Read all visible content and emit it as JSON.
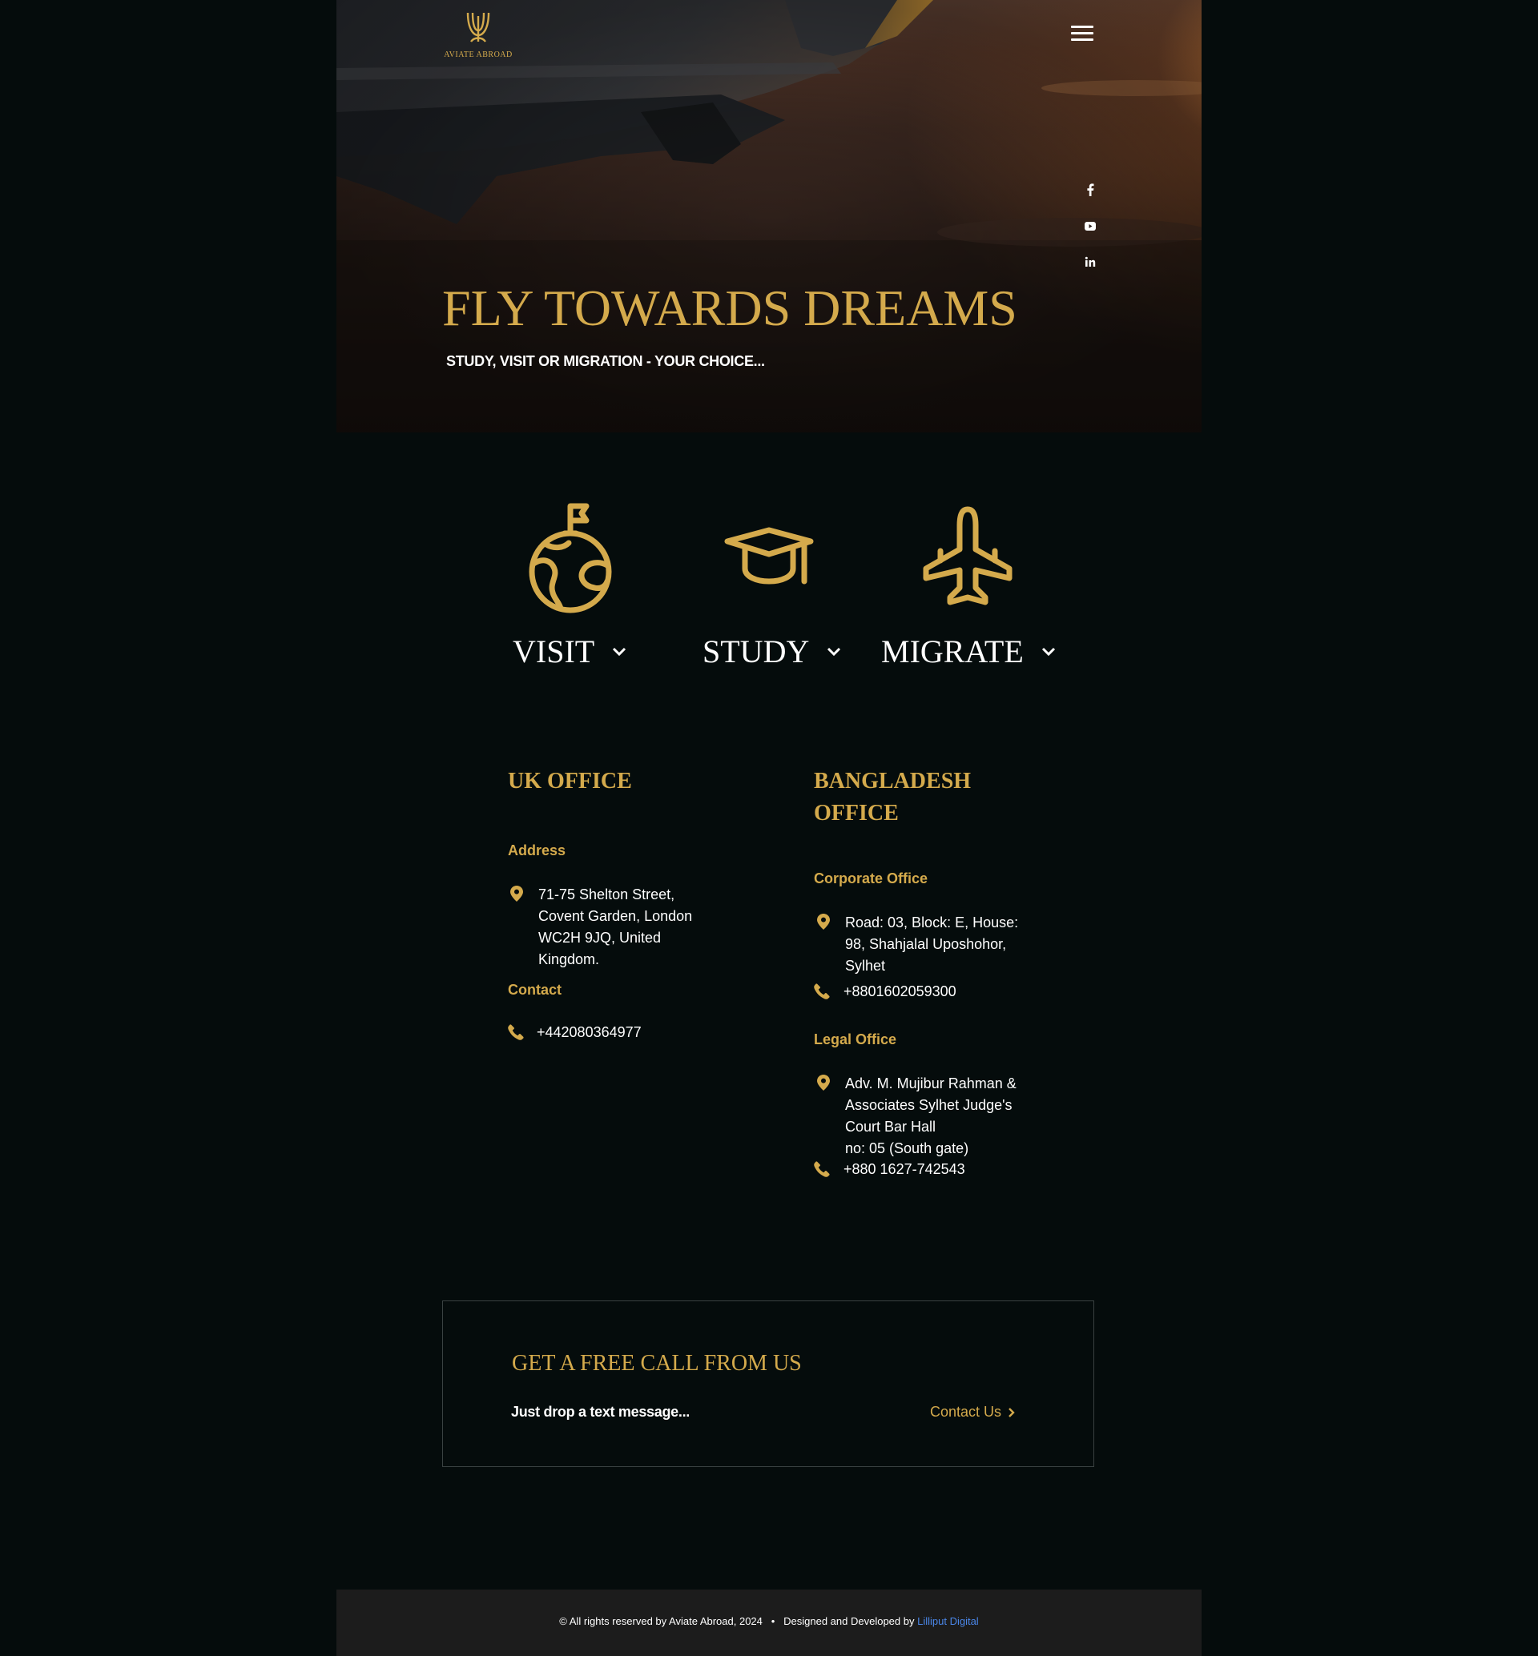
{
  "brand": {
    "name": "AVIATE ABROAD",
    "gold": "#d4aa4c"
  },
  "hero": {
    "title": "FLY TOWARDS DREAMS",
    "subtitle": "STUDY, VISIT OR MIGRATION - YOUR CHOICE...",
    "menu_icon": "hamburger-menu-icon",
    "social": [
      "facebook-icon",
      "youtube-icon",
      "linkedin-icon"
    ]
  },
  "services": [
    {
      "label": "VISIT",
      "icon": "globe-flag-icon"
    },
    {
      "label": "STUDY",
      "icon": "graduation-cap-icon"
    },
    {
      "label": "MIGRATE",
      "icon": "airplane-icon"
    }
  ],
  "uk_office": {
    "title": "UK OFFICE",
    "address_label": "Address",
    "address_lines": [
      "71-75 Shelton Street,",
      "Covent Garden, London",
      "WC2H 9JQ, United",
      "Kingdom."
    ],
    "contact_label": "Contact",
    "phone": "+442080364977"
  },
  "bd_office": {
    "title_line1": "BANGLADESH",
    "title_line2": "OFFICE",
    "corporate_label": "Corporate Office",
    "corporate_address_lines": [
      "Road: 03, Block: E, House:",
      "98, Shahjalal Uposhohor,",
      "Sylhet"
    ],
    "corporate_phone": "+8801602059300",
    "legal_label": "Legal Office",
    "legal_address_lines": [
      "Adv. M. Mujibur Rahman &",
      "Associates Sylhet Judge's",
      "Court Bar Hall",
      "no: 05 (South gate)"
    ],
    "legal_phone": "+880 1627-742543"
  },
  "cta": {
    "title": "GET A FREE CALL FROM US",
    "text": "Just drop a text message...",
    "link": "Contact Us"
  },
  "footer": {
    "copyright": "© All rights reserved by Aviate Abroad, 2024",
    "separator": "•",
    "credit_prefix": "Designed and Developed by",
    "credit_link": "Lilliput Digital"
  }
}
